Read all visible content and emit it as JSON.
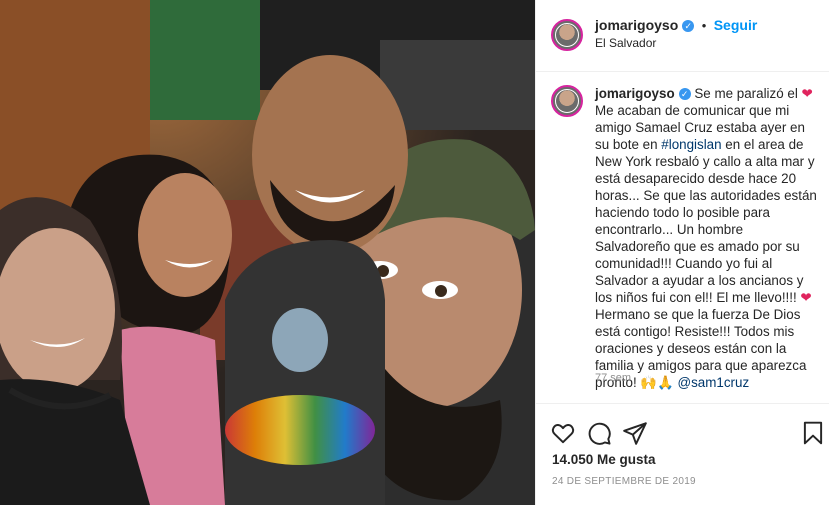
{
  "post": {
    "username": "jomarigoyso",
    "follow_label": "Seguir",
    "location": "El Salvador",
    "caption_intro": " Se me paralizó el ",
    "caption_line1": "Me acaban de comunicar que mi amigo Samael Cruz estaba ayer en su bote en ",
    "hashtag": "#longislan",
    "caption_line2": " en el area de New York resbaló y callo a alta mar y está desaparecido desde hace 20 horas... Se que las autoridades están haciendo todo lo posible para encontrarlo... Un hombre Salvadoreño que es amado por su comunidad!!! Cuando yo fui al Salvador a ayudar a los ancianos y los niños fui con el!! El me llevo!!!! ",
    "caption_line3": "Hermano se que la fuerza De Dios está contigo! Resiste!!! Todos mis oraciones y deseos están con la familia y amigos para que aparezca pronto! ",
    "caption_emoji": "🙌🙏",
    "mention": "@sam1cruz",
    "age": "77 sem",
    "likes": "14.050 Me gusta",
    "date": "24 DE SEPTIEMBRE DE 2019",
    "heart_emoji": "❤",
    "icons": [
      "verified-icon",
      "like-icon",
      "comment-icon",
      "share-icon",
      "save-icon"
    ]
  },
  "colors": {
    "accent": "#0095f6",
    "verified": "#3897f0",
    "heart": "#e0245e",
    "muted": "#8e8e8e"
  }
}
